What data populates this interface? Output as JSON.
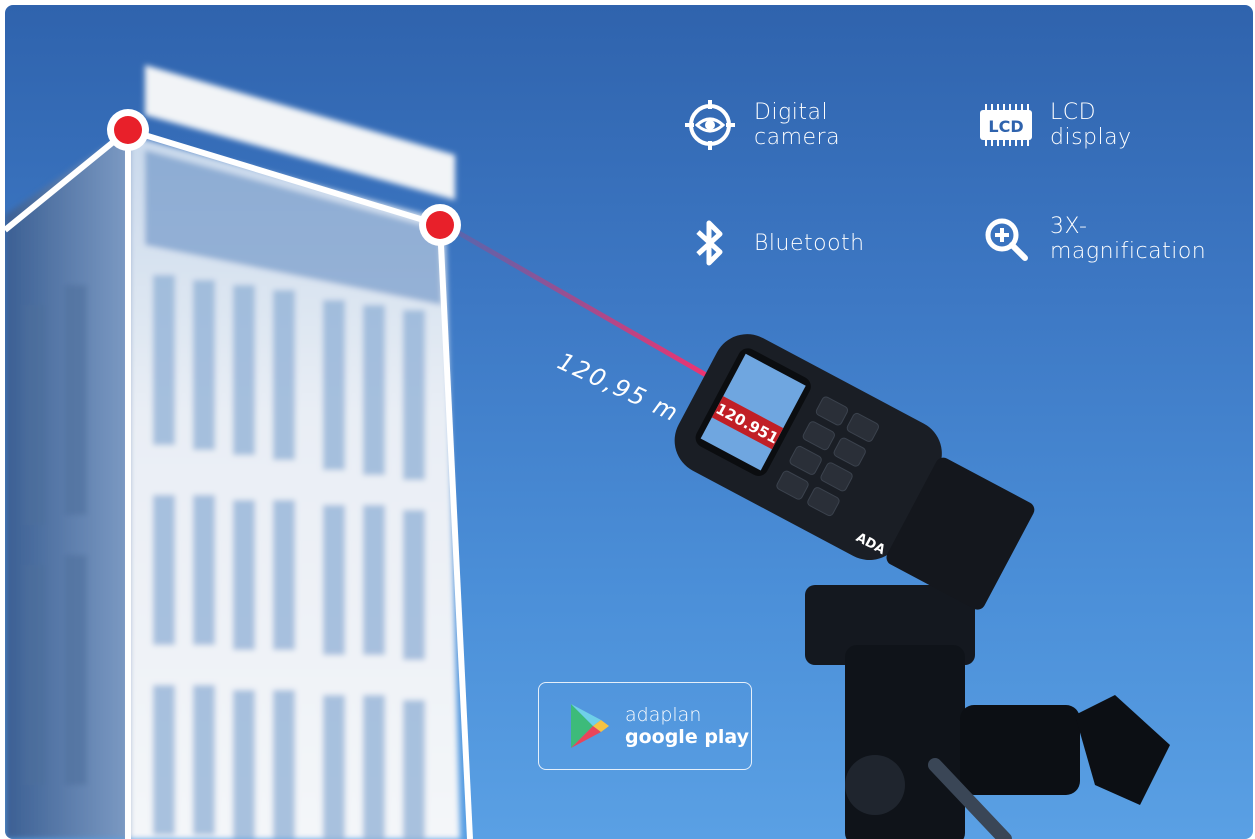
{
  "features": [
    {
      "icon": "camera-target-icon",
      "label": "Digital\ncamera"
    },
    {
      "icon": "lcd-chip-icon",
      "label": "LCD\ndisplay",
      "icon_text": "LCD"
    },
    {
      "icon": "bluetooth-icon",
      "label": "Bluetooth"
    },
    {
      "icon": "magnify-plus-icon",
      "label": "3X-\nmagnification"
    }
  ],
  "measurement": "120,95 m",
  "device": {
    "screen_reading": "120.951",
    "brand": "ADA"
  },
  "store_badge": {
    "line1": "adaplan",
    "line2": "google play",
    "icon": "play-store-icon"
  },
  "colors": {
    "sky_top": "#2f63ad",
    "sky_bottom": "#5aa0e4",
    "laser": "#e8245a",
    "marker": "#e8202a"
  }
}
